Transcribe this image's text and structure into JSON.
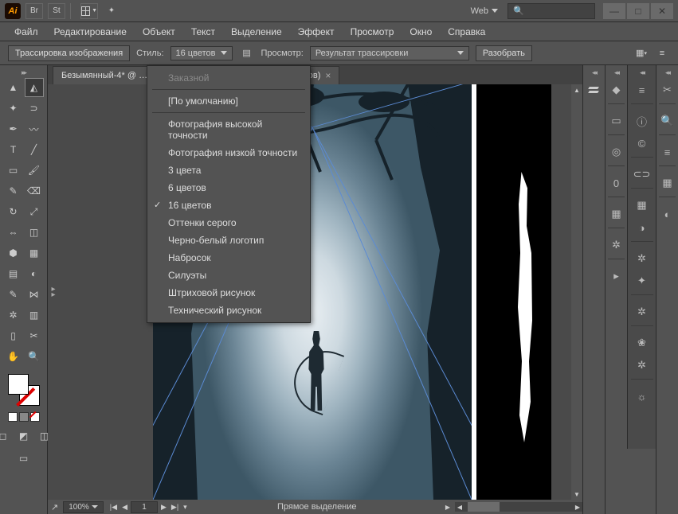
{
  "app": {
    "logo": "Ai",
    "doc_profile": "Web"
  },
  "window_controls": {
    "min": "—",
    "max": "□",
    "close": "✕"
  },
  "menu": [
    "Файл",
    "Редактирование",
    "Объект",
    "Текст",
    "Выделение",
    "Эффект",
    "Просмотр",
    "Окно",
    "Справка"
  ],
  "controlbar": {
    "trace_btn": "Трассировка изображения",
    "style_label": "Стиль:",
    "style_value": "16 цветов",
    "view_label": "Просмотр:",
    "view_value": "Результат трассировки",
    "expand_btn": "Разобрать"
  },
  "tab": {
    "title": "Безымянный-4* @ …ов)",
    "suffix": "ов)"
  },
  "dropdown": {
    "disabled": "Заказной",
    "items": [
      "[По умолчанию]",
      "Фотография высокой точности",
      "Фотография низкой точности",
      "3 цвета",
      "6 цветов",
      "16 цветов",
      "Оттенки серого",
      "Черно-белый логотип",
      "Набросок",
      "Силуэты",
      "Штриховой рисунок",
      "Технический рисунок"
    ],
    "checked_index": 5
  },
  "status": {
    "zoom": "100%",
    "artboard": "1",
    "tool": "Прямое выделение"
  },
  "tools": [
    [
      "selection-tool",
      "direct-selection-tool"
    ],
    [
      "magic-wand-tool",
      "lasso-tool"
    ],
    [
      "pen-tool",
      "curvature-tool"
    ],
    [
      "type-tool",
      "line-tool"
    ],
    [
      "rectangle-tool",
      "paintbrush-tool"
    ],
    [
      "pencil-tool",
      "eraser-tool"
    ],
    [
      "rotate-tool",
      "scale-tool"
    ],
    [
      "width-tool",
      "free-transform-tool"
    ],
    [
      "shape-builder-tool",
      "perspective-grid-tool"
    ],
    [
      "mesh-tool",
      "gradient-tool"
    ],
    [
      "eyedropper-tool",
      "blend-tool"
    ],
    [
      "symbol-sprayer-tool",
      "column-graph-tool"
    ],
    [
      "artboard-tool",
      "slice-tool"
    ],
    [
      "hand-tool",
      "zoom-tool"
    ]
  ],
  "tool_glyphs": [
    [
      "▲",
      "◭"
    ],
    [
      "✦",
      "⊃"
    ],
    [
      "✒",
      "〰"
    ],
    [
      "T",
      "╱"
    ],
    [
      "▭",
      "🖌"
    ],
    [
      "✎",
      "⌫"
    ],
    [
      "↻",
      "⤢"
    ],
    [
      "⇔",
      "◫"
    ],
    [
      "⬢",
      "▦"
    ],
    [
      "▤",
      "◐"
    ],
    [
      "✎",
      "⋈"
    ],
    [
      "✲",
      "▥"
    ],
    [
      "▯",
      "✂"
    ],
    [
      "✋",
      "🔍"
    ]
  ],
  "right_icons_col1": [
    "layers-icon",
    "stroke-icon",
    "appearance-icon",
    "type-panel-icon",
    "transparency-icon",
    "gear-icon",
    "play-icon"
  ],
  "right_glyphs_col1": [
    "◆",
    "▭",
    "◎",
    "0",
    "▦",
    "✲",
    "▸"
  ],
  "right_icons_col2": [
    "lines-icon",
    "info-icon",
    "cc-icon",
    "link-icon",
    "swatches-icon",
    "color-icon",
    "brush-icon",
    "symbol-icon",
    "gear2-icon",
    "flower-icon",
    "spray-icon",
    "sun-icon"
  ],
  "right_glyphs_col2": [
    "≡",
    "ⓘ",
    "©",
    "⊂⊃",
    "▦",
    "◑",
    "✲",
    "✦",
    "✲",
    "❀",
    "✲",
    "☼"
  ],
  "right_icons_far": [
    "crop-icon",
    "zoom-icon",
    "align-icon",
    "pathfinder-icon",
    "transform-icon"
  ],
  "right_glyphs_far": [
    "✂",
    "🔍",
    "≡",
    "▦",
    "◐"
  ]
}
